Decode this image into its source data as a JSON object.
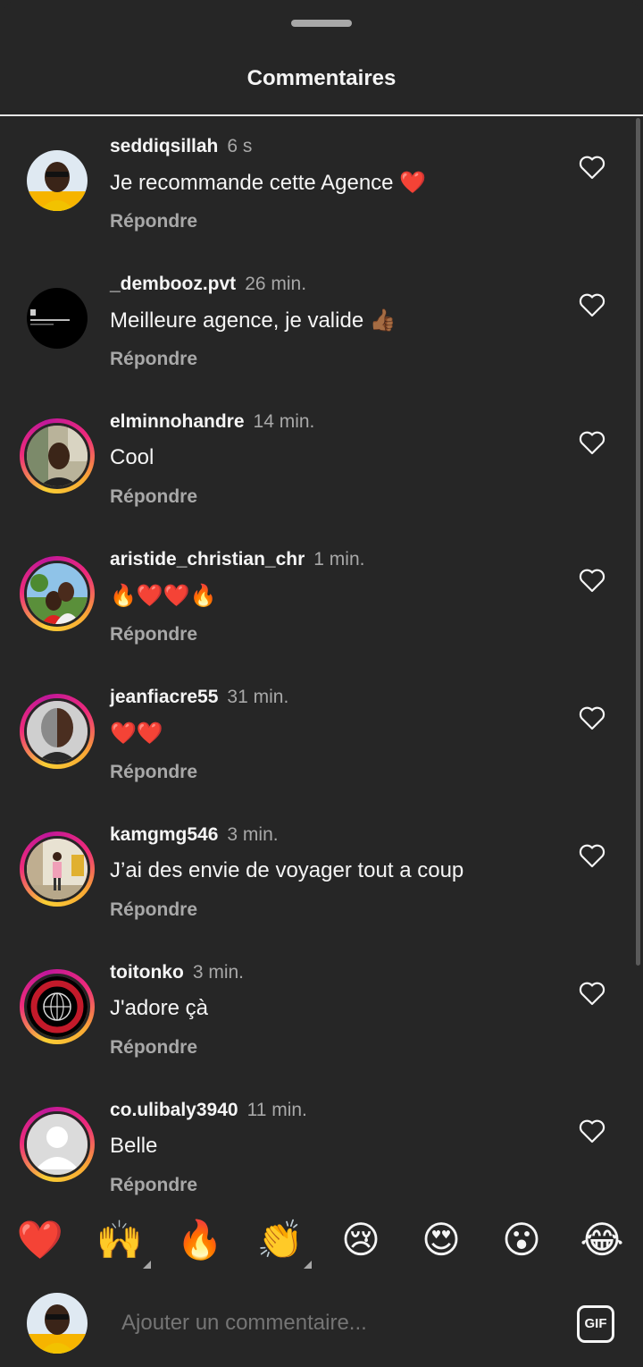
{
  "header": {
    "title": "Commentaires"
  },
  "reply_label": "Répondre",
  "comments": [
    {
      "username": "seddiqsillah",
      "time": "6 s",
      "text": "Je recommande cette Agence ❤️",
      "story_ring": false
    },
    {
      "username": "_dembooz.pvt",
      "time": "26 min.",
      "text": "Meilleure agence, je valide 👍🏾",
      "story_ring": false
    },
    {
      "username": "elminnohandre",
      "time": "14 min.",
      "text": "Cool",
      "story_ring": true
    },
    {
      "username": "aristide_christian_chr",
      "time": "1 min.",
      "text": "🔥❤️❤️🔥",
      "story_ring": true
    },
    {
      "username": "jeanfiacre55",
      "time": "31 min.",
      "text": "❤️❤️",
      "story_ring": true
    },
    {
      "username": "kamgmg546",
      "time": "3 min.",
      "text": "J’ai des envie de voyager tout a coup",
      "story_ring": true
    },
    {
      "username": "toitonko",
      "time": "3 min.",
      "text": "J'adore çà",
      "story_ring": true
    },
    {
      "username": "co.ulibaly3940",
      "time": "11 min.",
      "text": "Belle",
      "story_ring": true
    }
  ],
  "quick_reactions": [
    "❤️",
    "🙌",
    "🔥",
    "👏",
    "😢",
    "😍",
    "😮",
    "😂"
  ],
  "composer": {
    "placeholder": "Ajouter un commentaire...",
    "gif_label": "GIF"
  },
  "colors": {
    "background": "#262626",
    "text": "#f5f5f5",
    "secondary": "#a8a8a8",
    "story_ring_start": "#f9ce34",
    "story_ring_end": "#ee2a7b"
  }
}
